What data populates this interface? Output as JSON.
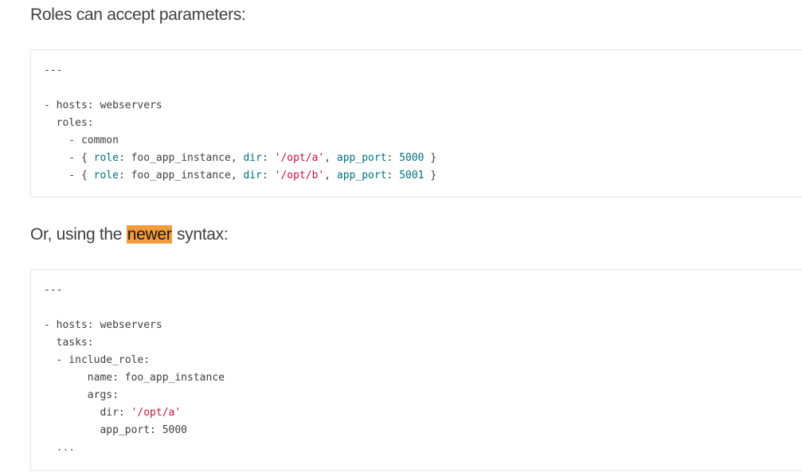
{
  "intro_text": "Roles can accept parameters:",
  "alt_text_before": "Or, using the ",
  "alt_text_highlight": "newer",
  "alt_text_after": " syntax:",
  "code1": {
    "l1": "---",
    "l3_dash": "- ",
    "l3_key": "hosts",
    "l3_val": ": webservers",
    "l4": "  roles:",
    "l5": "    - common",
    "l6_pre": "    - { ",
    "l6_k1": "role",
    "l6_v1": ": foo_app_instance, ",
    "l6_k2": "dir",
    "l6_c2": ": ",
    "l6_s2": "'/opt/a'",
    "l6_c3": ", ",
    "l6_k3": "app_port",
    "l6_c4": ": ",
    "l6_n3": "5000",
    "l6_end": " }",
    "l7_pre": "    - { ",
    "l7_k1": "role",
    "l7_v1": ": foo_app_instance, ",
    "l7_k2": "dir",
    "l7_c2": ": ",
    "l7_s2": "'/opt/b'",
    "l7_c3": ", ",
    "l7_k3": "app_port",
    "l7_c4": ": ",
    "l7_n3": "5001",
    "l7_end": " }"
  },
  "code2": {
    "l1": "---",
    "l3": "- hosts: webservers",
    "l4": "  tasks:",
    "l5": "  - include_role:",
    "l6": "       name: foo_app_instance",
    "l7": "       args:",
    "l8_pre": "         dir: ",
    "l8_str": "'/opt/a'",
    "l9": "         app_port: 5000",
    "l10": "  ..."
  }
}
